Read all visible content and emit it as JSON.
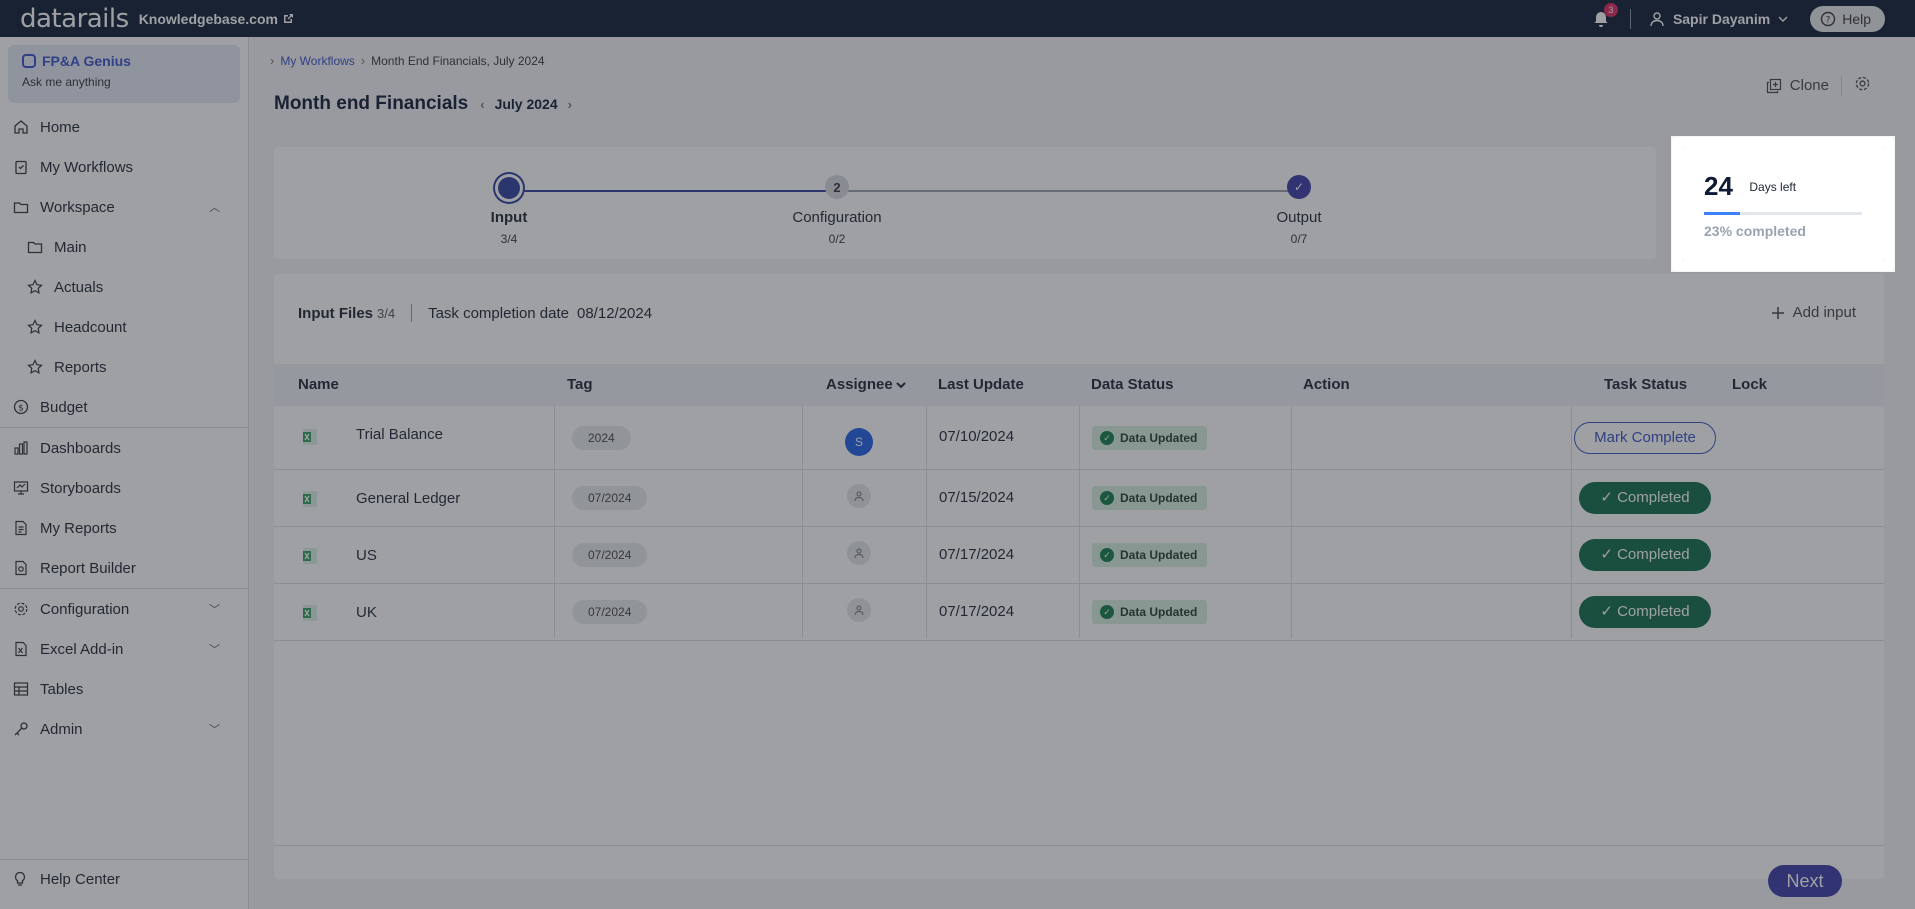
{
  "topbar": {
    "logo": "datarails",
    "site": "Knowledgebase.com",
    "notification_count": "3",
    "user_name": "Sapir Dayanim",
    "help_label": "Help"
  },
  "sidebar": {
    "genius_title": "FP&A Genius",
    "genius_sub": "Ask me anything",
    "items": [
      {
        "label": "Home"
      },
      {
        "label": "My Workflows"
      },
      {
        "label": "Workspace"
      },
      {
        "label": "Main"
      },
      {
        "label": "Actuals"
      },
      {
        "label": "Headcount"
      },
      {
        "label": "Reports"
      },
      {
        "label": "Budget"
      },
      {
        "label": "Dashboards"
      },
      {
        "label": "Storyboards"
      },
      {
        "label": "My Reports"
      },
      {
        "label": "Report Builder"
      },
      {
        "label": "Configuration"
      },
      {
        "label": "Excel Add-in"
      },
      {
        "label": "Tables"
      },
      {
        "label": "Admin"
      }
    ],
    "help_center": "Help Center"
  },
  "breadcrumb": {
    "root": "My Workflows",
    "current": "Month End Financials, July 2024"
  },
  "header": {
    "title": "Month end Financials",
    "period": "July 2024",
    "clone_label": "Clone"
  },
  "steps": [
    {
      "label": "Input",
      "count": "3/4",
      "marker": ""
    },
    {
      "label": "Configuration",
      "count": "0/2",
      "marker": "2"
    },
    {
      "label": "Output",
      "count": "0/7",
      "marker": "✓"
    }
  ],
  "days": {
    "number": "24",
    "label": "Days left",
    "percent_text": "23% completed",
    "progress": 0.23
  },
  "files": {
    "title": "Input Files",
    "count": "3/4",
    "completion_label": "Task completion date",
    "completion_date": "08/12/2024",
    "add_input": "Add input"
  },
  "table": {
    "headers": {
      "name": "Name",
      "tag": "Tag",
      "assignee": "Assignee",
      "last_update": "Last Update",
      "data_status": "Data Status",
      "action": "Action",
      "task_status": "Task Status",
      "lock": "Lock"
    },
    "rows": [
      {
        "name": "Trial Balance",
        "tag": "2024",
        "assignee": "S",
        "last_update": "07/10/2024",
        "data_status": "Data Updated",
        "task_status": "Mark Complete"
      },
      {
        "name": "General Ledger",
        "tag": "07/2024",
        "assignee": "",
        "last_update": "07/15/2024",
        "data_status": "Data Updated",
        "task_status": "Completed"
      },
      {
        "name": "US",
        "tag": "07/2024",
        "assignee": "",
        "last_update": "07/17/2024",
        "data_status": "Data Updated",
        "task_status": "Completed"
      },
      {
        "name": "UK",
        "tag": "07/2024",
        "assignee": "",
        "last_update": "07/17/2024",
        "data_status": "Data Updated",
        "task_status": "Completed"
      }
    ]
  },
  "next_label": "Next",
  "colors": {
    "accent": "#3a51c7",
    "completed": "#0f6b4a",
    "topbar": "#0e1a33"
  }
}
